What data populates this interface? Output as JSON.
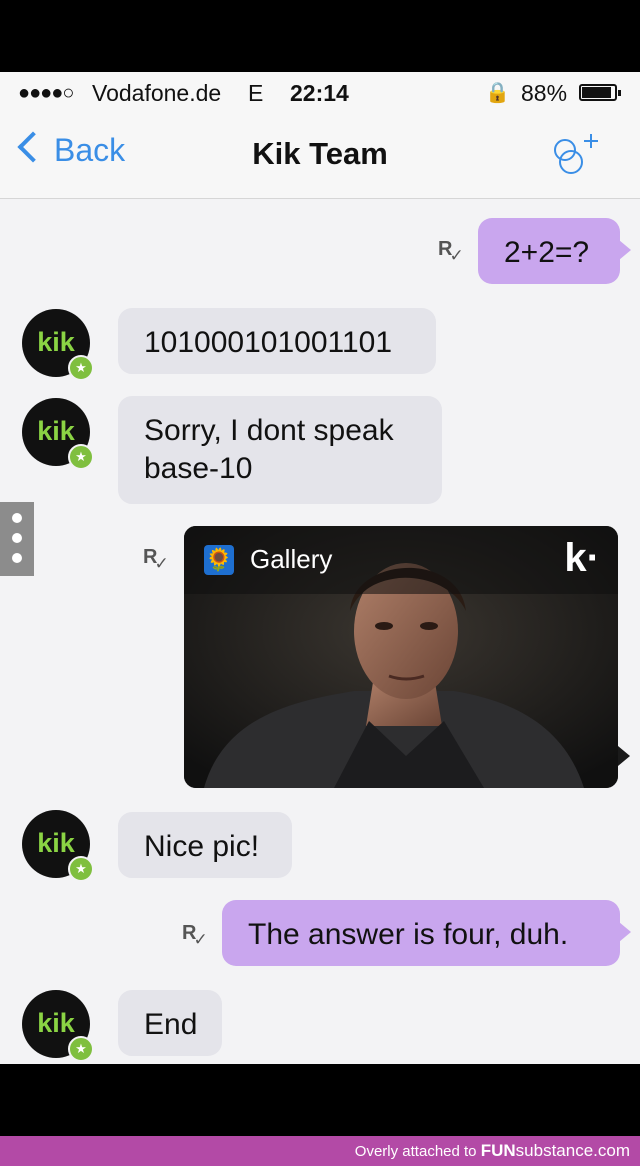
{
  "status_bar": {
    "signal": "●●●●○",
    "carrier": "Vodafone.de",
    "network": "E",
    "time": "22:14",
    "lock_glyph": "🔒",
    "battery": "88%"
  },
  "nav": {
    "back_label": "Back",
    "title": "Kik Team"
  },
  "avatar_text": "kik",
  "messages": {
    "m1": {
      "text": "2+2=?",
      "receipt": "R"
    },
    "m2": {
      "text": "101000101001101"
    },
    "m3": {
      "text": "Sorry, I dont speak\nbase-10"
    },
    "m4": {
      "gallery_label": "Gallery",
      "brand": "k·",
      "receipt": "R"
    },
    "m5": {
      "text": "Nice pic!"
    },
    "m6": {
      "text": "The answer is four, duh.",
      "receipt": "R"
    },
    "m7": {
      "text": "End"
    }
  },
  "footer": {
    "tagline": "Overly attached to",
    "brand_bold": "FUN",
    "brand_rest": "substance.com"
  },
  "colors": {
    "accent": "#3a8ee6",
    "outgoing_bubble": "#c9a6ee",
    "incoming_bubble": "#e4e4ea",
    "kik_green": "#8bd444",
    "footer": "#b34aa6"
  }
}
